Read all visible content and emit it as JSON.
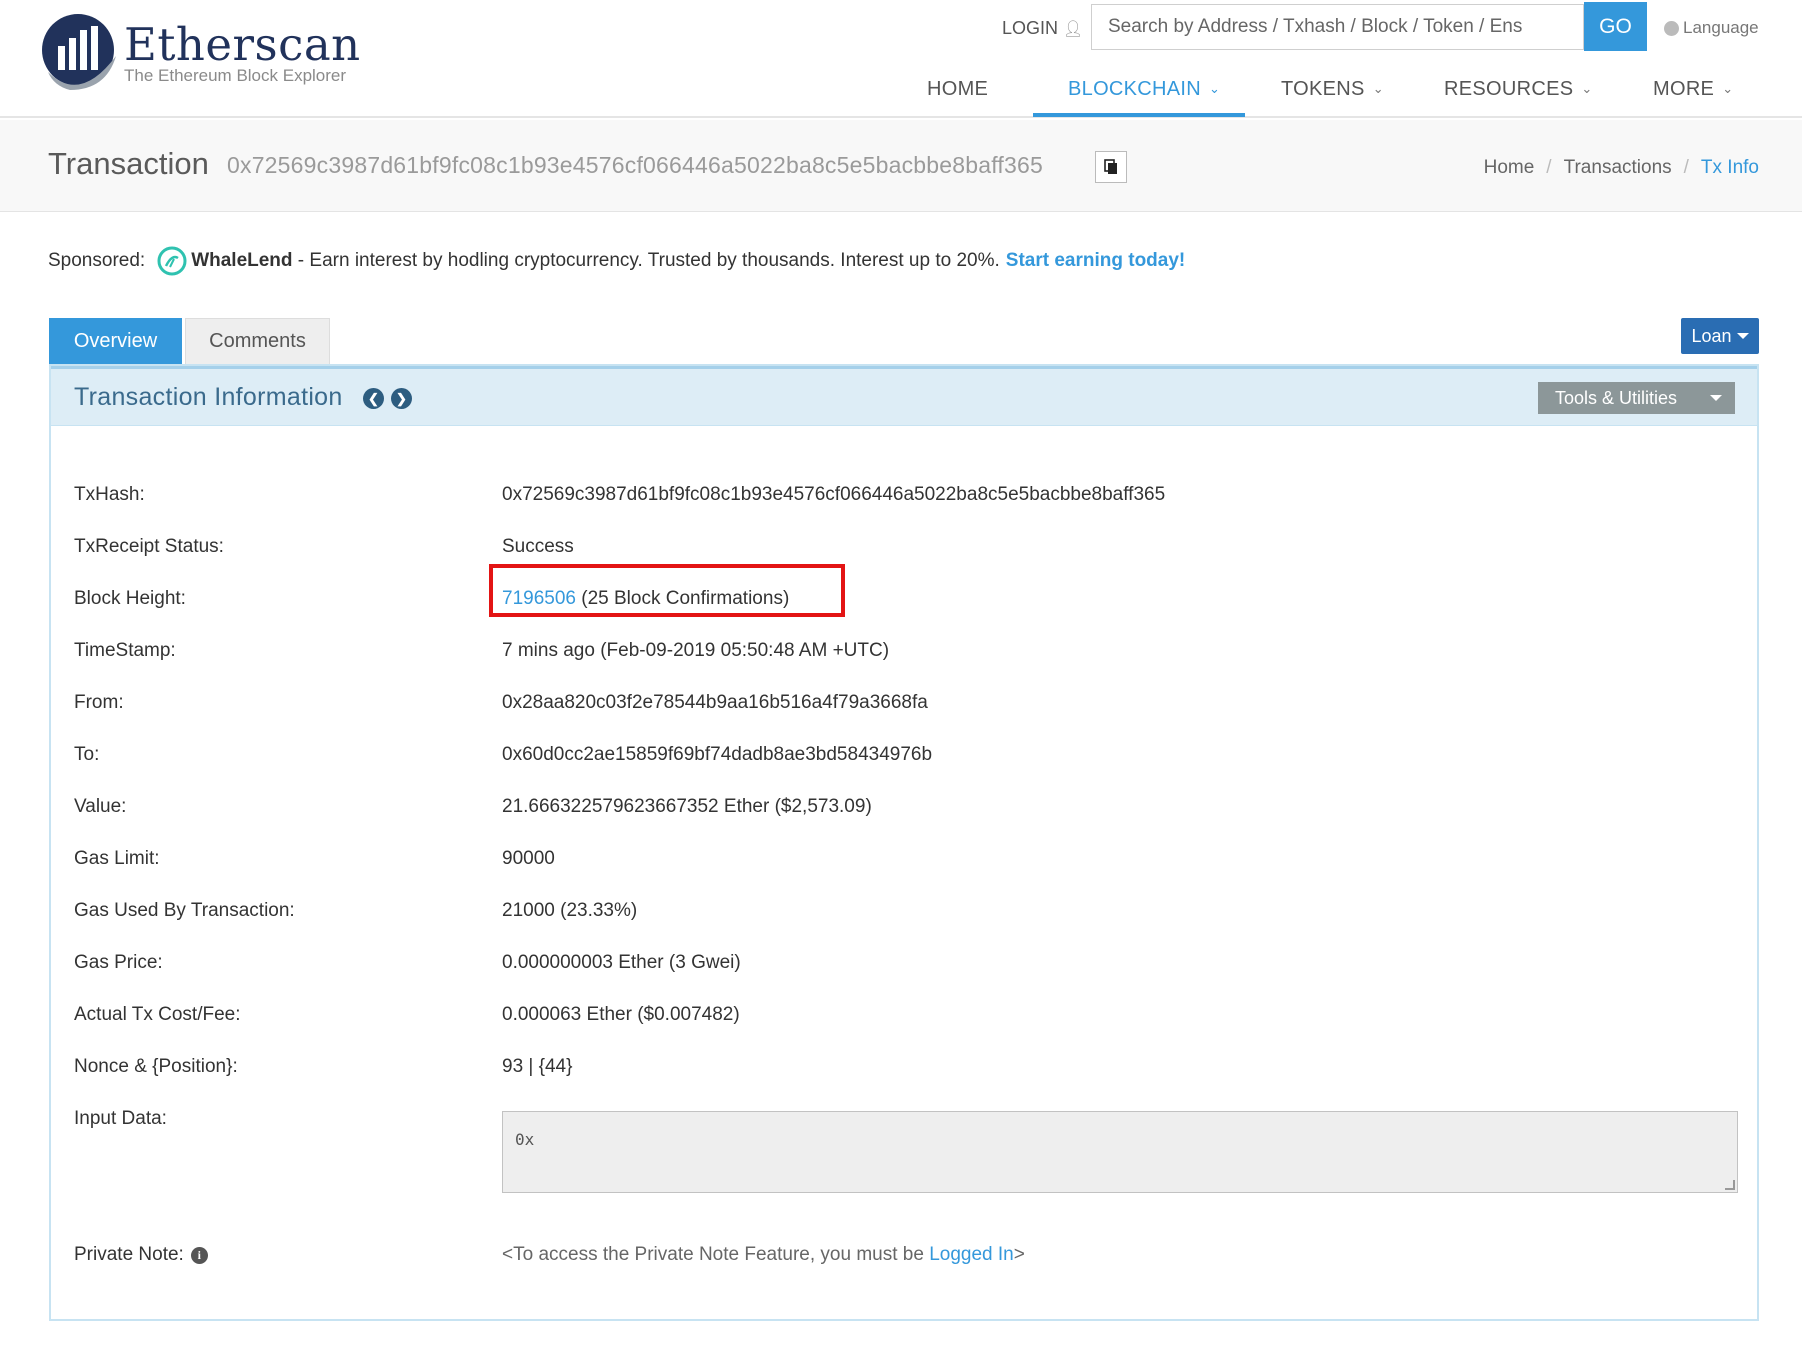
{
  "brand": {
    "name": "Etherscan",
    "tagline": "The Ethereum Block Explorer"
  },
  "header": {
    "login": "LOGIN",
    "search_placeholder": "Search by Address / Txhash / Block / Token / Ens",
    "go": "GO",
    "language": "Language"
  },
  "nav": {
    "home": "HOME",
    "blockchain": "BLOCKCHAIN",
    "tokens": "TOKENS",
    "resources": "RESOURCES",
    "more": "MORE"
  },
  "page": {
    "title": "Transaction",
    "hash": "0x72569c3987d61bf9fc08c1b93e4576cf066446a5022ba8c5e5bacbbe8baff365"
  },
  "breadcrumb": {
    "home": "Home",
    "transactions": "Transactions",
    "current": "Tx Info"
  },
  "sponsored": {
    "label": "Sponsored:",
    "name": "WhaleLend",
    "text": " - Earn interest by hodling cryptocurrency. Trusted by thousands. Interest up to 20%.",
    "cta": "Start earning today!"
  },
  "tabs": {
    "overview": "Overview",
    "comments": "Comments"
  },
  "loan": "Loan",
  "panel": {
    "title": "Transaction Information",
    "tools": "Tools & Utilities"
  },
  "tx": {
    "txhash_label": "TxHash:",
    "txhash": "0x72569c3987d61bf9fc08c1b93e4576cf066446a5022ba8c5e5bacbbe8baff365",
    "status_label": "TxReceipt Status:",
    "status": "Success",
    "block_label": "Block Height:",
    "block": "7196506",
    "confirmations": "(25 Block Confirmations)",
    "timestamp_label": "TimeStamp:",
    "timestamp": "7 mins ago (Feb-09-2019 05:50:48 AM +UTC)",
    "from_label": "From:",
    "from": "0x28aa820c03f2e78544b9aa16b516a4f79a3668fa",
    "to_label": "To:",
    "to": "0x60d0cc2ae15859f69bf74dadb8ae3bd58434976b",
    "value_label": "Value:",
    "value": "21.666322579623667352 Ether ($2,573.09)",
    "gas_limit_label": "Gas Limit:",
    "gas_limit": "90000",
    "gas_used_label": "Gas Used By Transaction:",
    "gas_used": "21000 (23.33%)",
    "gas_price_label": "Gas Price:",
    "gas_price": "0.000000003 Ether (3 Gwei)",
    "fee_label": "Actual Tx Cost/Fee:",
    "fee": "0.000063 Ether ($0.007482)",
    "nonce_label": "Nonce & {Position}:",
    "nonce": "93 | {44}",
    "input_label": "Input Data:",
    "input": "0x",
    "private_label": "Private Note:",
    "private_prefix": "<To access the Private Note Feature, you must be ",
    "private_link": "Logged In",
    "private_suffix": ">"
  },
  "colors": {
    "accent": "#3498db",
    "brand_dark": "#21325b",
    "success": "#198b19",
    "highlight": "#e31414",
    "panel_header": "#ddedf6"
  }
}
